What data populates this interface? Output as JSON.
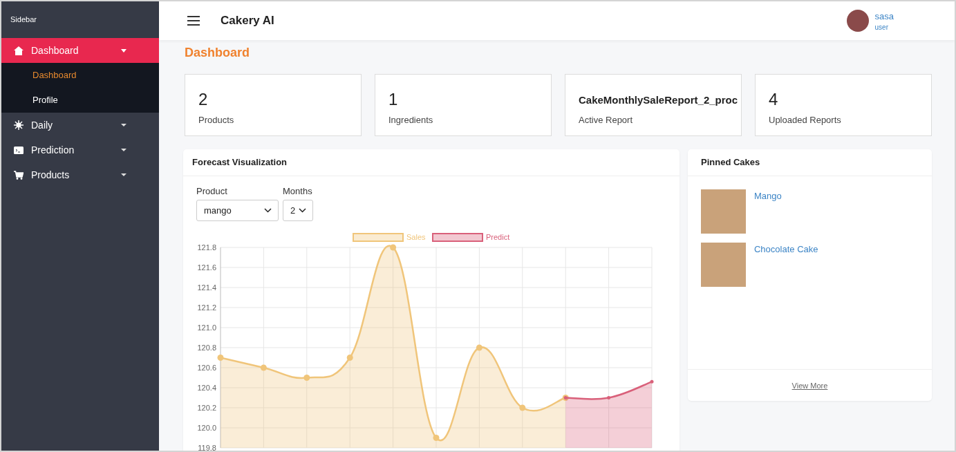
{
  "sidebar": {
    "title": "Sidebar",
    "items": [
      {
        "label": "Dashboard",
        "kind": "home",
        "selected": true,
        "expanded": true,
        "children": [
          {
            "label": "Dashboard",
            "selected": true
          },
          {
            "label": "Profile",
            "selected": false
          }
        ]
      },
      {
        "label": "Daily",
        "kind": "sun",
        "selected": false,
        "expanded": false
      },
      {
        "label": "Prediction",
        "kind": "terminal",
        "selected": false,
        "expanded": false
      },
      {
        "label": "Products",
        "kind": "cart",
        "selected": false,
        "expanded": false
      }
    ]
  },
  "header": {
    "title": "Cakery AI",
    "user": {
      "name": "sasa",
      "role": "user"
    }
  },
  "page_title": "Dashboard",
  "stats": [
    {
      "value": "2",
      "label": "Products",
      "kind": "number"
    },
    {
      "value": "1",
      "label": "Ingredients",
      "kind": "number"
    },
    {
      "value": "CakeMonthlySaleReport_2_proc",
      "label": "Active Report",
      "kind": "name"
    },
    {
      "value": "4",
      "label": "Uploaded Reports",
      "kind": "number"
    }
  ],
  "forecast": {
    "title": "Forecast Visualization",
    "product": {
      "label": "Product",
      "value": "mango"
    },
    "months": {
      "label": "Months",
      "value": "2"
    },
    "chart_data": {
      "type": "area",
      "series": [
        {
          "name": "Sales",
          "color": "#f0c57a",
          "values": [
            120.7,
            120.6,
            120.5,
            120.7,
            121.8,
            119.9,
            120.8,
            120.2,
            120.3,
            null,
            null
          ]
        },
        {
          "name": "Predict",
          "color": "#d9607a",
          "values": [
            null,
            null,
            null,
            null,
            null,
            null,
            null,
            null,
            120.3,
            120.3,
            120.46
          ]
        }
      ],
      "ylim": [
        119.8,
        121.8
      ],
      "grid": true,
      "yticks": [
        119.8,
        {
          "value": 120,
          "label": "120.0"
        },
        120.2,
        120.4,
        120.6,
        120.8,
        {
          "value": 121,
          "label": "121.0"
        },
        121.2,
        121.4,
        121.6,
        121.8
      ]
    }
  },
  "pinned": {
    "title": "Pinned Cakes",
    "items": [
      {
        "name": "Mango"
      },
      {
        "name": "Chocolate Cake"
      }
    ],
    "footer": "View More"
  }
}
